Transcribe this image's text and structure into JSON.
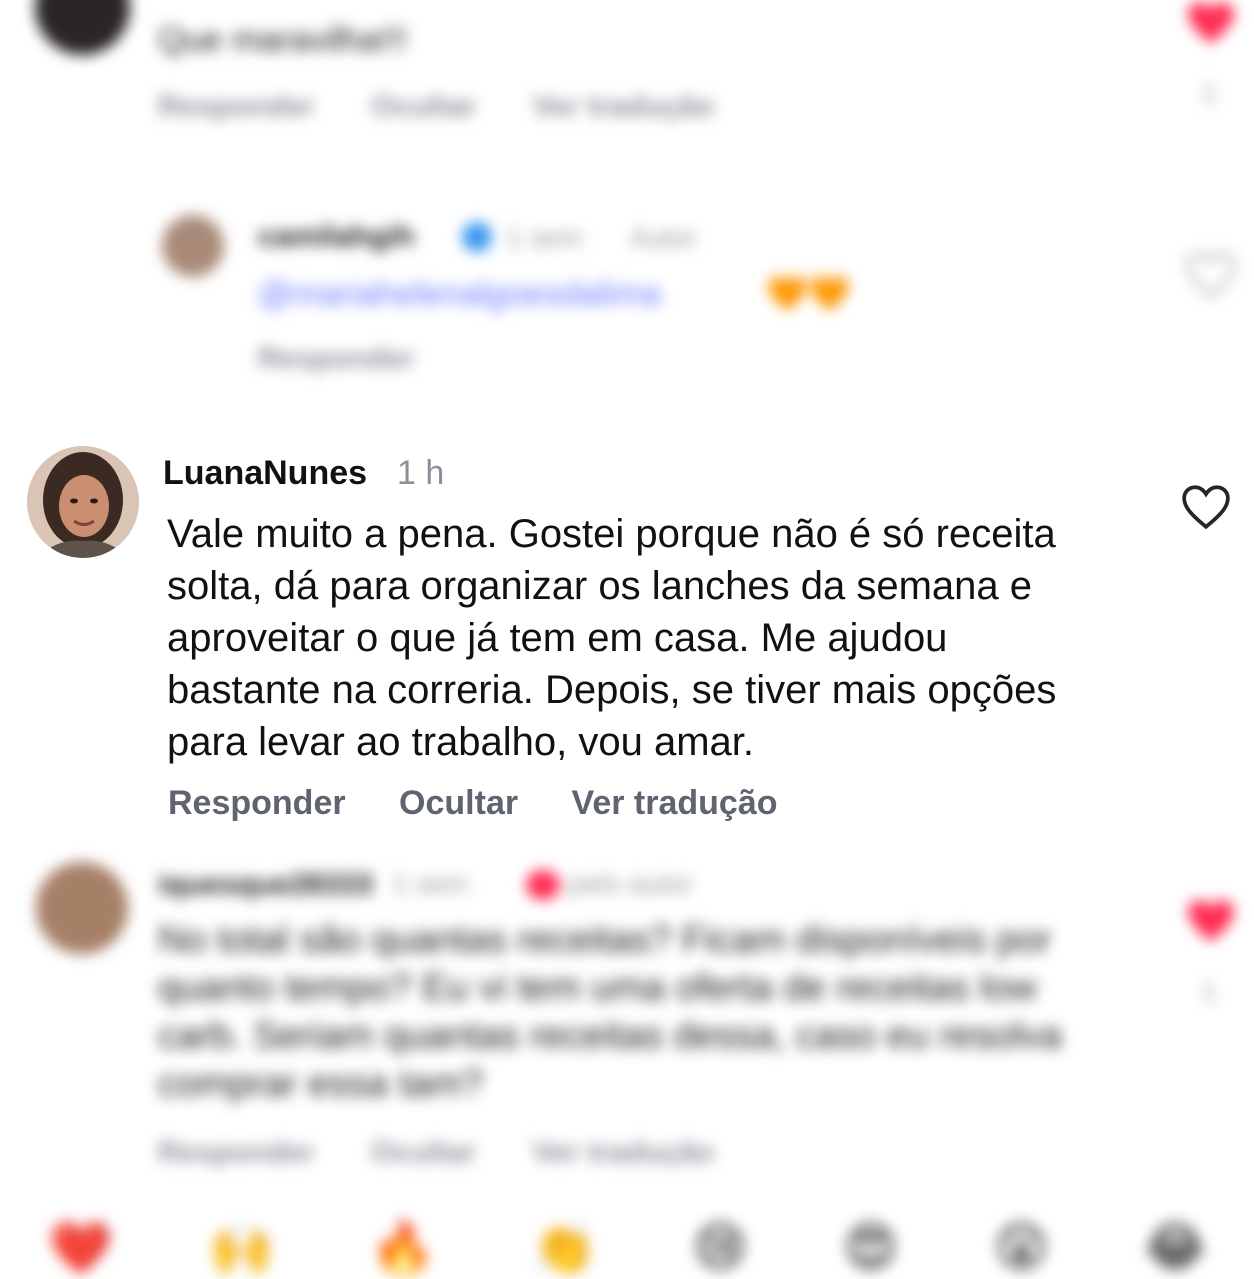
{
  "comments": [
    {
      "username": "",
      "time": "",
      "text": "Que maravilha!!!",
      "actions": [
        "Responder",
        "Ocultar",
        "Ver tradução"
      ],
      "liked": true,
      "like_count": "1"
    },
    {
      "username": "camilahgih",
      "verified": true,
      "time": "1 sem",
      "extra": "Autor",
      "mention": "@mariahelenalgoesdalima",
      "emoji": "🧡🧡",
      "actions": [
        "Responder"
      ],
      "liked": false
    },
    {
      "username": "LuanaNunes",
      "time": "1 h",
      "text": "Vale muito a pena. Gostei porque não é só receita solta, dá para organizar os lanches da semana e aproveitar o que já tem em casa. Me ajudou bastante na correria. Depois, se tiver mais opções para levar ao trabalho, vou amar.",
      "actions": [
        "Responder",
        "Ocultar",
        "Ver tradução"
      ],
      "liked": false
    },
    {
      "username": "iquesque28333",
      "time": "1 sem",
      "badge": "pelo autor",
      "text": "No total são quantas receitas? Ficam disponíveis por quanto tempo? Eu vi tem uma oferta de receitas low carb. Seriam quantas receitas dessa, caso eu resolva comprar essa tam?",
      "actions": [
        "Responder",
        "Ocultar",
        "Ver tradução"
      ],
      "liked": true,
      "like_count": "1"
    }
  ],
  "emoji_bar": [
    "❤️",
    "🙌",
    "🔥",
    "👏",
    "😢",
    "😍",
    "😮",
    "😂"
  ],
  "colors": {
    "accent_red": "#ff2d55",
    "mention": "#6b7bff",
    "muted": "#8a8f99"
  }
}
